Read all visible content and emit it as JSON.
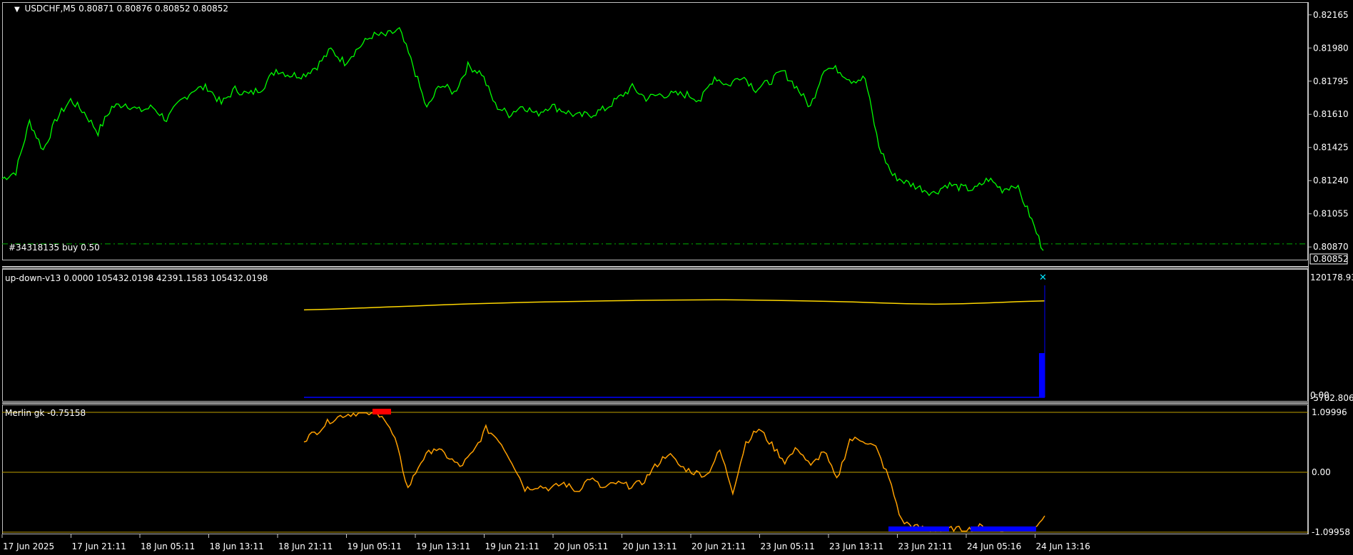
{
  "colors": {
    "background": "#000000",
    "price_line": "#00ff00",
    "trade_level": "#00b000",
    "updown_line": "#ffd700",
    "updown_hist": "#0000ff",
    "updown_marker": "#00e5ff",
    "merlin_line": "#ffa000",
    "merlin_high": "#ff0000",
    "merlin_low": "#0000ff",
    "frame": "#c0c0c0"
  },
  "header": {
    "arrow": "▼",
    "symbol_label": "USDCHF,M5  0.80871 0.80876 0.80852 0.80852"
  },
  "trade_label": "#34318135 buy 0.50",
  "current_price_tag": "0.80852",
  "updown_label": "up-down-v13 0.0000 105432.0198 42391.1583 105432.0198",
  "merlin_label": "Merlin gk -0.75158",
  "chart_data": [
    {
      "type": "line",
      "name": "USDCHF,M5",
      "x": [
        "17 Jun 2025",
        "17 Jun 21:11",
        "18 Jun 05:11",
        "18 Jun 13:11",
        "18 Jun 21:11",
        "19 Jun 05:11",
        "19 Jun 13:11",
        "19 Jun 21:11",
        "20 Jun 05:11",
        "20 Jun 13:11",
        "20 Jun 21:11",
        "23 Jun 05:11",
        "23 Jun 13:11",
        "23 Jun 21:11",
        "24 Jun 05:16",
        "24 Jun 13:16"
      ],
      "y_ticks": [
        "0.82165",
        "0.81980",
        "0.81795",
        "0.81610",
        "0.81425",
        "0.81240",
        "0.81055",
        "0.80870",
        "0.80852"
      ],
      "ylim": [
        0.80815,
        0.822
      ],
      "trade_level": 0.80887,
      "values": [
        0.8125,
        0.8129,
        0.8157,
        0.8141,
        0.8159,
        0.8169,
        0.8162,
        0.8151,
        0.8165,
        0.8167,
        0.8163,
        0.8165,
        0.8158,
        0.8168,
        0.8175,
        0.8176,
        0.8167,
        0.8175,
        0.8172,
        0.8176,
        0.8186,
        0.8183,
        0.8183,
        0.8188,
        0.8197,
        0.819,
        0.8198,
        0.8205,
        0.8205,
        0.8208,
        0.8188,
        0.8164,
        0.8178,
        0.8173,
        0.8188,
        0.8184,
        0.8166,
        0.8161,
        0.8166,
        0.8161,
        0.8166,
        0.8163,
        0.816,
        0.8161,
        0.8164,
        0.817,
        0.8176,
        0.817,
        0.8172,
        0.8172,
        0.8172,
        0.8169,
        0.8182,
        0.8177,
        0.8183,
        0.8175,
        0.8179,
        0.8185,
        0.8176,
        0.8165,
        0.8187,
        0.8186,
        0.818,
        0.8181,
        0.8143,
        0.8127,
        0.8123,
        0.812,
        0.8117,
        0.8122,
        0.812,
        0.8119,
        0.8125,
        0.8119,
        0.8122,
        0.8105,
        0.8085
      ]
    },
    {
      "type": "line",
      "name": "up-down-v13",
      "y_ticks": [
        "120178.93",
        "0.00",
        "-5702.806"
      ],
      "ylim": [
        -5702.806,
        120178.93
      ],
      "line_values": [
        105432,
        106200,
        107400,
        108500,
        109600,
        110800,
        111800,
        112600,
        113400,
        114000,
        114500,
        115000,
        115500,
        115800,
        116000,
        116200,
        116000,
        115600,
        115200,
        114600,
        113900,
        112900,
        112000,
        111500,
        112000,
        113000,
        114200,
        115000
      ],
      "hist_last": 42391.1583
    },
    {
      "type": "line",
      "name": "Merlin gk",
      "y_ticks": [
        "1.09996",
        "0.00",
        "-1.09958"
      ],
      "ylim": [
        -1.09958,
        1.09996
      ],
      "values": [
        0.6,
        0.75,
        0.95,
        1.05,
        1.09,
        1.08,
        1.07,
        0.6,
        -0.3,
        0.2,
        0.45,
        0.3,
        0.1,
        0.35,
        0.8,
        0.6,
        0.2,
        -0.3,
        -0.25,
        -0.3,
        -0.2,
        -0.35,
        -0.1,
        -0.3,
        -0.2,
        -0.25,
        -0.2,
        0.1,
        0.35,
        0.1,
        0.0,
        -0.05,
        0.4,
        -0.35,
        0.55,
        0.8,
        0.5,
        0.2,
        0.45,
        0.1,
        0.4,
        -0.15,
        0.6,
        0.6,
        0.45,
        -0.1,
        -0.9,
        -1.0,
        -1.05,
        -1.07,
        -1.04,
        -1.06,
        -1.0,
        -1.06,
        -1.05,
        -1.03,
        -1.02,
        -0.8
      ]
    }
  ]
}
